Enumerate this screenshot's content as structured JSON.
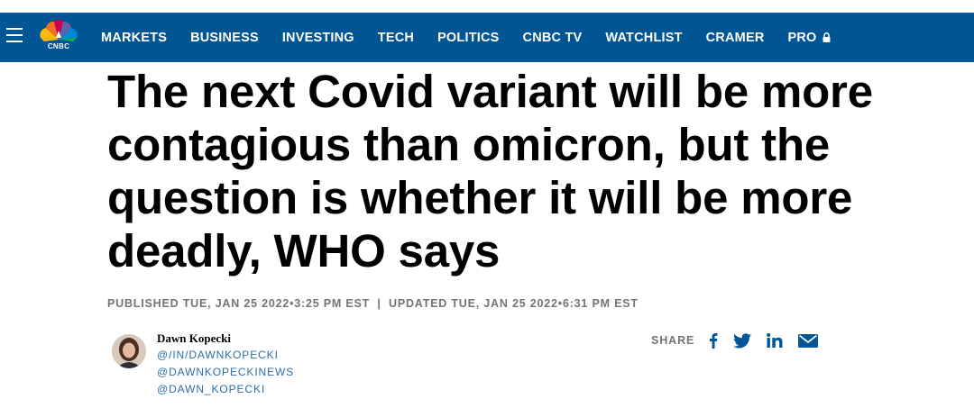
{
  "header": {
    "brand": "CNBC",
    "nav": [
      {
        "label": "MARKETS"
      },
      {
        "label": "BUSINESS"
      },
      {
        "label": "INVESTING"
      },
      {
        "label": "TECH"
      },
      {
        "label": "POLITICS"
      },
      {
        "label": "CNBC TV"
      },
      {
        "label": "WATCHLIST"
      },
      {
        "label": "CRAMER"
      },
      {
        "label": "PRO",
        "icon": "lock-icon"
      }
    ],
    "colors": {
      "bar": "#005594",
      "text": "#ffffff"
    }
  },
  "article": {
    "headline": "The next Covid variant will be more contagious than omicron, but the question is whether it will be more deadly, WHO says",
    "published": "PUBLISHED TUE, JAN 25 2022•3:25 PM EST",
    "separator": "|",
    "updated": "UPDATED TUE, JAN 25 2022•6:31 PM EST"
  },
  "author": {
    "name": "Dawn Kopecki",
    "links": [
      "@/IN/DAWNKOPECKI",
      "@DAWNKOPECKINEWS",
      "@DAWN_KOPECKI"
    ],
    "link_color": "#2b6ea8"
  },
  "share": {
    "label": "SHARE",
    "icons": [
      "facebook-icon",
      "twitter-icon",
      "linkedin-icon",
      "email-icon"
    ],
    "icon_color": "#005594"
  }
}
